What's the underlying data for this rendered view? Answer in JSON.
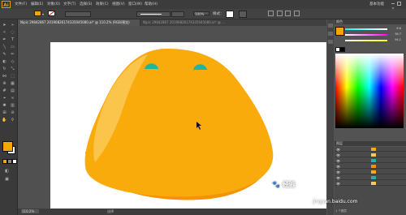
{
  "app": {
    "logo": "Ai"
  },
  "menu": {
    "items": [
      "文件(F)",
      "编辑(E)",
      "对象(O)",
      "文字(T)",
      "选择(S)",
      "效果(C)",
      "视图(V)",
      "窗口(W)",
      "帮助(H)"
    ]
  },
  "control_bar": {
    "fill_color": "#f7a500",
    "opacity": "100%",
    "style_label": "样式：",
    "workspace": "基本功能"
  },
  "document": {
    "active_tab": "Nipic 29842867 20190826174335045080.ai* @ 110.2% (RGB/预览)",
    "inactive_tab": "Nipic 29842867 20190826174335045080.ai* @ ..."
  },
  "colors": {
    "face": "#f9ab0c",
    "face_shadow": "#f39308",
    "highlight": "#fcc857",
    "eye": "#22b4a0"
  },
  "panels": {
    "color_panel_title": "颜色",
    "layers_panel_title": "图层",
    "slider_values": [
      "6.6",
      "36.7",
      "94.1"
    ],
    "layer_count": "1 个图层"
  },
  "status": {
    "zoom": "110.2%",
    "tool_name": "选择"
  },
  "watermark": {
    "brand": "经验",
    "site": "jingyan.baidu.com"
  }
}
